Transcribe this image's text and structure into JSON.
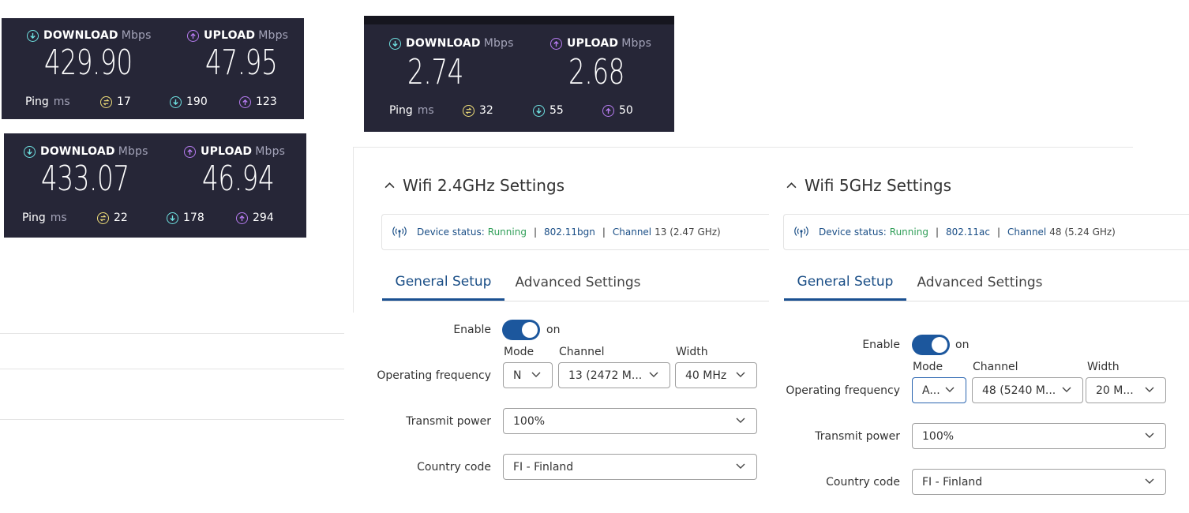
{
  "speedtests": [
    {
      "download_label": "DOWNLOAD",
      "upload_label": "UPLOAD",
      "unit": "Mbps",
      "download": "429.90",
      "upload": "47.95",
      "ping_label": "Ping",
      "ping_unit": "ms",
      "ping": "17",
      "ping_down": "190",
      "ping_up": "123"
    },
    {
      "download_label": "DOWNLOAD",
      "upload_label": "UPLOAD",
      "unit": "Mbps",
      "download": "433.07",
      "upload": "46.94",
      "ping_label": "Ping",
      "ping_unit": "ms",
      "ping": "22",
      "ping_down": "178",
      "ping_up": "294"
    },
    {
      "download_label": "DOWNLOAD",
      "upload_label": "UPLOAD",
      "unit": "Mbps",
      "download": "2.74",
      "upload": "2.68",
      "ping_label": "Ping",
      "ping_unit": "ms",
      "ping": "32",
      "ping_down": "55",
      "ping_up": "50"
    }
  ],
  "wifi24": {
    "title": "Wifi 2.4GHz Settings",
    "status_label": "Device status:",
    "status": "Running",
    "standard": "802.11bgn",
    "channel_label": "Channel",
    "channel": "13 (2.47 GHz)",
    "tab_general": "General Setup",
    "tab_advanced": "Advanced Settings",
    "enable_label": "Enable",
    "enable_state": "on",
    "mode_label": "Mode",
    "channel_col_label": "Channel",
    "width_label": "Width",
    "opfreq_label": "Operating frequency",
    "mode_value": "N",
    "channel_value": "13 (2472 M...",
    "width_value": "40 MHz",
    "txpower_label": "Transmit power",
    "txpower_value": "100%",
    "country_label": "Country code",
    "country_value": "FI - Finland"
  },
  "wifi5": {
    "title": "Wifi 5GHz Settings",
    "status_label": "Device status:",
    "status": "Running",
    "standard": "802.11ac",
    "channel_label": "Channel",
    "channel": "48 (5.24 GHz)",
    "tab_general": "General Setup",
    "tab_advanced": "Advanced Settings",
    "enable_label": "Enable",
    "enable_state": "on",
    "mode_label": "Mode",
    "channel_col_label": "Channel",
    "width_label": "Width",
    "opfreq_label": "Operating frequency",
    "mode_value": "A...",
    "channel_value": "48 (5240 M...",
    "width_value": "20 M...",
    "txpower_label": "Transmit power",
    "txpower_value": "100%",
    "country_label": "Country code",
    "country_value": "FI - Finland"
  },
  "colors": {
    "panel_bg": "#262637",
    "download": "#6fe1e1",
    "upload": "#b77cf1",
    "ping": "#f2e07a",
    "accent": "#1a4e86",
    "running": "#2f9e57"
  }
}
